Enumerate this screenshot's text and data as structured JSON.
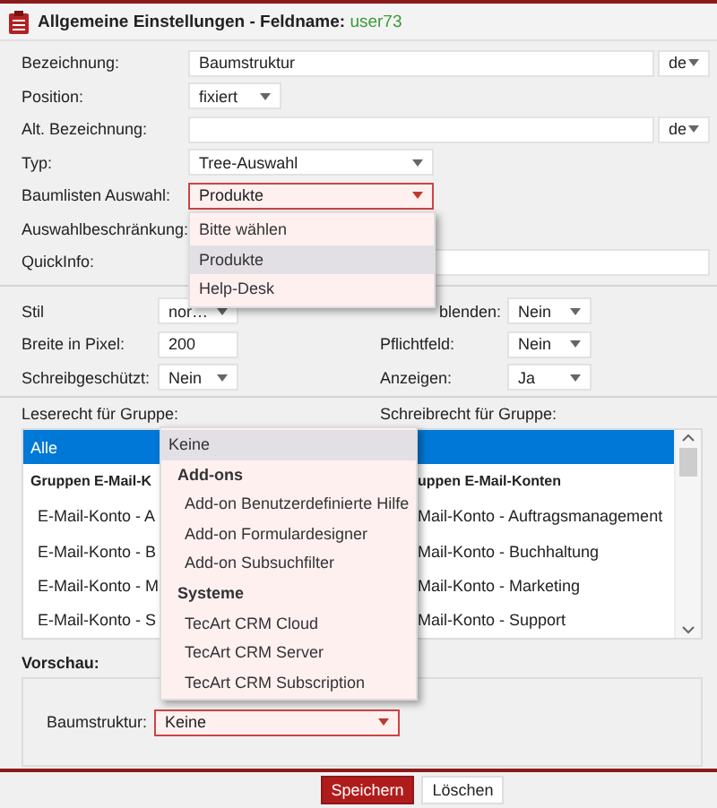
{
  "header": {
    "title": "Allgemeine Einstellungen - Feldname:",
    "field_name": "user73"
  },
  "fields": [
    {
      "kind": "text",
      "label": "Bezeichnung:",
      "value": "Baumstruktur",
      "lang": "de"
    },
    {
      "kind": "short_select",
      "label": "Position:",
      "value": "fixiert",
      "open": false
    },
    {
      "kind": "text",
      "label": "Alt. Bezeichnung:",
      "lang": "de"
    },
    {
      "kind": "select",
      "label": "Typ:",
      "value": "Tree-Auswahl",
      "open": false
    },
    {
      "kind": "select",
      "label": "Baumlisten Auswahl:",
      "value": "Produkte",
      "open": true
    },
    {
      "kind": "label",
      "label": "Auswahlbeschränkung:"
    },
    {
      "kind": "text",
      "label": "QuickInfo:"
    }
  ],
  "tree_list_menu": [
    {
      "label": "Bitte wählen",
      "selected": false
    },
    {
      "label": "Produkte",
      "selected": true
    },
    {
      "label": "Help-Desk",
      "selected": false
    }
  ],
  "options": [
    {
      "label": "Stil",
      "value": "nor…",
      "kind": "select",
      "right_label": "blenden:",
      "right_label_covered": true,
      "right_value": "Nein"
    },
    {
      "label": "Breite in Pixel:",
      "value": "200",
      "kind": "input",
      "right_label": "Pflichtfeld:",
      "right_label_covered": false,
      "right_value": "Nein"
    },
    {
      "label": "Schreibgeschützt:",
      "value": "Nein",
      "kind": "select",
      "right_label": "Anzeigen:",
      "right_label_covered": false,
      "right_value": "Ja"
    }
  ],
  "groups": {
    "read_label": "Leserecht für Gruppe:",
    "write_label": "Schreibrecht für Gruppe:",
    "rows": [
      {
        "kind": "all",
        "read": "Alle",
        "selected": true
      },
      {
        "kind": "group",
        "read": "Gruppen E-Mail-K",
        "write": "uppen E-Mail-Konten",
        "selected": false
      },
      {
        "kind": "item",
        "read": "E-Mail-Konto - A",
        "write": "Mail-Konto - Auftragsmanagement",
        "selected": false
      },
      {
        "kind": "item",
        "read": "E-Mail-Konto - B",
        "write": "Mail-Konto - Buchhaltung",
        "selected": false
      },
      {
        "kind": "item",
        "read": "E-Mail-Konto - M",
        "write": "Mail-Konto - Marketing",
        "selected": false
      },
      {
        "kind": "item",
        "read": "E-Mail-Konto - S",
        "write": "Mail-Konto - Support",
        "selected": false
      }
    ]
  },
  "preview": {
    "title": "Vorschau:",
    "label": "Baumstruktur:",
    "value": "Keine"
  },
  "preview_menu": [
    {
      "kind": "option",
      "label": "Keine",
      "selected": true
    },
    {
      "kind": "group",
      "label": "Add-ons"
    },
    {
      "kind": "option",
      "label": "Add-on Benutzerdefinierte Hilfe",
      "selected": false
    },
    {
      "kind": "option",
      "label": "Add-on Formulardesigner",
      "selected": false
    },
    {
      "kind": "option",
      "label": "Add-on Subsuchfilter",
      "selected": false
    },
    {
      "kind": "group",
      "label": "Systeme"
    },
    {
      "kind": "option",
      "label": "TecArt CRM Cloud",
      "selected": false
    },
    {
      "kind": "option",
      "label": "TecArt CRM Server",
      "selected": false
    },
    {
      "kind": "option",
      "label": "TecArt CRM Subscription",
      "selected": false
    }
  ],
  "buttons": [
    {
      "label": "Speichern",
      "kind": "primary"
    },
    {
      "label": "Löschen",
      "kind": "secondary"
    }
  ]
}
